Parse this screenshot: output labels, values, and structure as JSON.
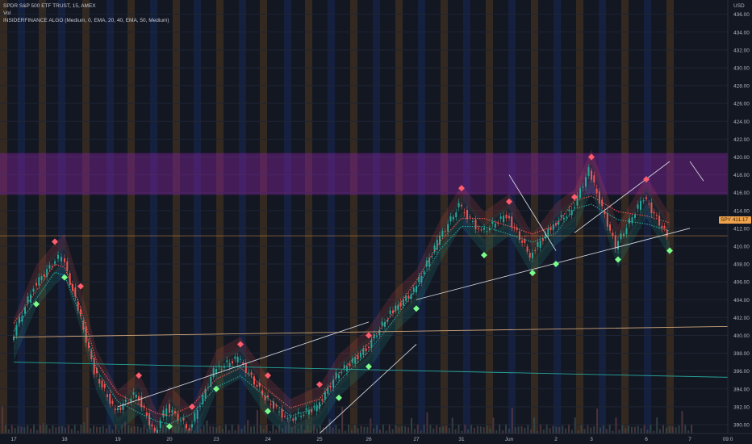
{
  "legend": {
    "symbol": "SPDR S&P 500 ETF TRUST, 15, AMEX",
    "volume": "Vol",
    "indicator": "INSIDERFINANCE ALGO (Medium, 0, EMA, 20, 40, EMA, 50, Medium)"
  },
  "currency": "USD",
  "last_price_label": "SPY 411.17",
  "colors": {
    "background": "#131722",
    "up": "#26a69a",
    "down": "#ef5350",
    "zone": "#8e24aa",
    "session_a": "#1e3a8a",
    "session_b": "#8a5a1e",
    "trendline": "#d1d4dc",
    "resistance_line": "#c9a27a",
    "support_line": "#26a69a",
    "price_line": "#f0a24b"
  },
  "chart_data": {
    "type": "candlestick",
    "title": "SPDR S&P 500 ETF TRUST, 15, AMEX",
    "y_axis": {
      "ticks": [
        390,
        392,
        394,
        396,
        398,
        400,
        402,
        404,
        406,
        408,
        410,
        412,
        414,
        416,
        418,
        420,
        422,
        424,
        426,
        428,
        430,
        432,
        434,
        436
      ],
      "range": [
        389,
        437
      ]
    },
    "x_axis": {
      "labels": [
        "17",
        "18",
        "19",
        "20",
        "23",
        "24",
        "25",
        "26",
        "27",
        "31",
        "Jun",
        "2",
        "3",
        "6",
        "7",
        "09:0"
      ]
    },
    "price_path": [
      {
        "t": "17",
        "price": 399.5
      },
      {
        "t": "17b",
        "price": 405.5
      },
      {
        "t": "17c",
        "price": 408.0
      },
      {
        "t": "18",
        "price": 409.0
      },
      {
        "t": "18b",
        "price": 403.0
      },
      {
        "t": "18c",
        "price": 396.0
      },
      {
        "t": "19",
        "price": 391.5
      },
      {
        "t": "19b",
        "price": 393.5
      },
      {
        "t": "19c",
        "price": 389.0
      },
      {
        "t": "20",
        "price": 392.0
      },
      {
        "t": "20b",
        "price": 389.5
      },
      {
        "t": "23",
        "price": 396.0
      },
      {
        "t": "23b",
        "price": 397.5
      },
      {
        "t": "24",
        "price": 393.0
      },
      {
        "t": "24b",
        "price": 390.5
      },
      {
        "t": "25",
        "price": 392.0
      },
      {
        "t": "25b",
        "price": 395.5
      },
      {
        "t": "26",
        "price": 398.5
      },
      {
        "t": "26b",
        "price": 402.5
      },
      {
        "t": "27",
        "price": 405.0
      },
      {
        "t": "27b",
        "price": 410.5
      },
      {
        "t": "31",
        "price": 414.5
      },
      {
        "t": "31b",
        "price": 411.5
      },
      {
        "t": "Jun",
        "price": 413.5
      },
      {
        "t": "Junb",
        "price": 409.0
      },
      {
        "t": "2",
        "price": 412.5
      },
      {
        "t": "2b",
        "price": 414.0
      },
      {
        "t": "3",
        "price": 418.5
      },
      {
        "t": "3b",
        "price": 410.0
      },
      {
        "t": "6",
        "price": 415.5
      },
      {
        "t": "6b",
        "price": 411.17
      }
    ],
    "supply_zone": {
      "from": 415.8,
      "to": 420.4
    },
    "last_price": 411.17,
    "signals_up": [
      {
        "t": "17b",
        "price": 403.5
      },
      {
        "t": "18",
        "price": 406.5
      },
      {
        "t": "19c",
        "price": 387.5
      },
      {
        "t": "20",
        "price": 389.8
      },
      {
        "t": "23",
        "price": 394.0
      },
      {
        "t": "24",
        "price": 391.5
      },
      {
        "t": "25b",
        "price": 393.0
      },
      {
        "t": "26",
        "price": 396.5
      },
      {
        "t": "27",
        "price": 403.0
      },
      {
        "t": "31b",
        "price": 409.0
      },
      {
        "t": "Junb",
        "price": 407.0
      },
      {
        "t": "2",
        "price": 408.0
      },
      {
        "t": "3b",
        "price": 408.5
      },
      {
        "t": "6b",
        "price": 409.5
      }
    ],
    "signals_down": [
      {
        "t": "17c",
        "price": 410.5
      },
      {
        "t": "18b",
        "price": 405.5
      },
      {
        "t": "19b",
        "price": 395.5
      },
      {
        "t": "20b",
        "price": 392.0
      },
      {
        "t": "23b",
        "price": 399.0
      },
      {
        "t": "24",
        "price": 395.5
      },
      {
        "t": "25",
        "price": 394.5
      },
      {
        "t": "26",
        "price": 400.0
      },
      {
        "t": "31",
        "price": 416.5
      },
      {
        "t": "Jun",
        "price": 415.0
      },
      {
        "t": "2b",
        "price": 415.5
      },
      {
        "t": "3",
        "price": 420.0
      },
      {
        "t": "6",
        "price": 417.5
      }
    ],
    "trendlines": [
      {
        "from": {
          "t": "17",
          "price": 399.8
        },
        "to": {
          "t": "09:0",
          "price": 401.0
        },
        "role": "resistance"
      },
      {
        "from": {
          "t": "17",
          "price": 397.0
        },
        "to": {
          "t": "09:0",
          "price": 395.3
        },
        "role": "support"
      },
      {
        "from": {
          "t": "19",
          "price": 392.0
        },
        "to": {
          "t": "26",
          "price": 401.5
        },
        "role": "rising"
      },
      {
        "from": {
          "t": "25",
          "price": 389.0
        },
        "to": {
          "t": "27",
          "price": 399.0
        },
        "role": "rising"
      },
      {
        "from": {
          "t": "27",
          "price": 404.0
        },
        "to": {
          "t": "7",
          "price": 412.0
        },
        "role": "rising"
      },
      {
        "from": {
          "t": "2b",
          "price": 411.5
        },
        "to": {
          "t": "6b",
          "price": 419.5
        },
        "role": "rising"
      },
      {
        "from": {
          "t": "Jun",
          "price": 418.0
        },
        "to": {
          "t": "2",
          "price": 409.5
        },
        "role": "falling"
      },
      {
        "from": {
          "t": "7",
          "price": 419.5
        },
        "to": {
          "t": "7b",
          "price": 417.3
        },
        "role": "falling"
      }
    ]
  }
}
